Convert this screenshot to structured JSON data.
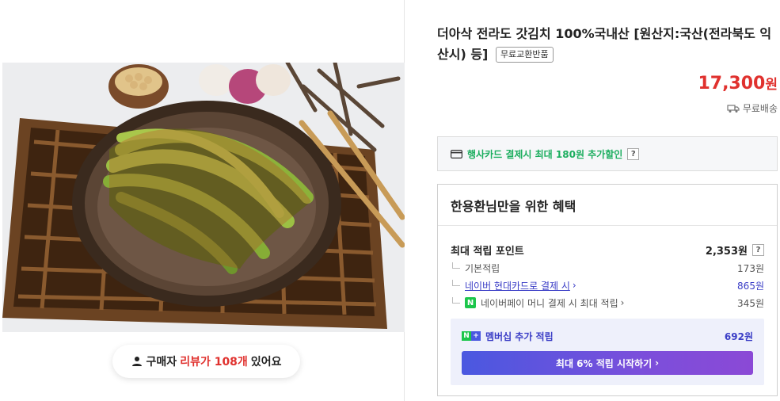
{
  "review": {
    "prefix": "구매자",
    "highlight": "리뷰가 108개",
    "suffix": "있어요"
  },
  "product": {
    "title": "더아삭 전라도 갓김치 100%국내산 [원산지:국산(전라북도 익산시) 등]",
    "tag": "무료교환반품",
    "price": "17,300",
    "price_unit": "원",
    "shipping": "무료배송"
  },
  "card_promo": {
    "text": "행사카드 결제시 최대 180원 추가할인",
    "help": "?"
  },
  "benefits": {
    "heading": "한용환님만을 위한 혜택",
    "max_points_label": "최대 적립 포인트",
    "max_points_value": "2,353원",
    "help": "?",
    "rows": [
      {
        "label": "기본적립",
        "value": "173원"
      },
      {
        "label": "네이버 현대카드로 결제 시",
        "value": "865원"
      },
      {
        "label": "네이버페이 머니 결제 시 최대 적립",
        "value": "345원"
      }
    ],
    "membership_label": "멤버십 추가 적립",
    "membership_value": "692원",
    "cta": "최대 6% 적립 시작하기"
  },
  "colors": {
    "price": "#e0312e",
    "accent_green": "#1cae5f",
    "accent_blue": "#3a3dc6"
  }
}
